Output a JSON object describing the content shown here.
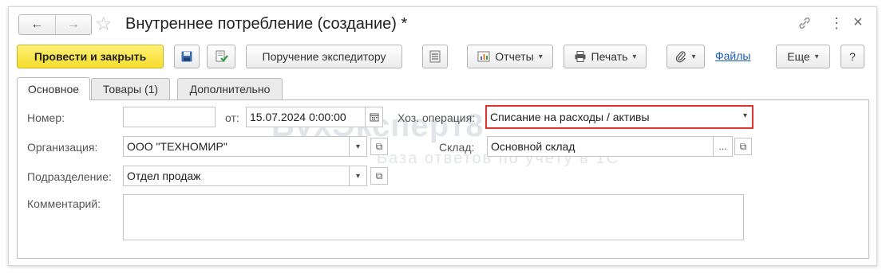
{
  "window": {
    "title": "Внутреннее потребление (создание) *",
    "nav": {
      "back_icon": "←",
      "forward_icon": "→"
    },
    "controls": {
      "link_icon": "🔗",
      "more_icon": "⋮",
      "close_icon": "×"
    }
  },
  "toolbar": {
    "post_close_label": "Провести и закрыть",
    "courier_label": "Поручение экспедитору",
    "reports_label": "Отчеты",
    "print_label": "Печать",
    "files_label": "Файлы",
    "more_label": "Еще",
    "help_label": "?"
  },
  "tabs": [
    {
      "label": "Основное",
      "active": true
    },
    {
      "label": "Товары (1)",
      "active": false
    },
    {
      "label": "Дополнительно",
      "active": false
    }
  ],
  "form": {
    "number_label": "Номер:",
    "number_value": "",
    "date_prefix": "от:",
    "date_value": "15.07.2024  0:00:00",
    "operation_label": "Хоз. операция:",
    "operation_value": "Списание на расходы / активы",
    "org_label": "Организация:",
    "org_value": "ООО \"ТЕХНОМИР\"",
    "warehouse_label": "Склад:",
    "warehouse_value": "Основной склад",
    "dept_label": "Подразделение:",
    "dept_value": "Отдел продаж",
    "comment_label": "Комментарий:",
    "comment_value": ""
  },
  "watermark": {
    "brand": "БухЭксперт8",
    "tagline": "База ответов по учету в 1С"
  },
  "colors": {
    "primary_button": "#f5dc2c",
    "highlight_border": "#e03131",
    "link": "#1a5fb4"
  }
}
